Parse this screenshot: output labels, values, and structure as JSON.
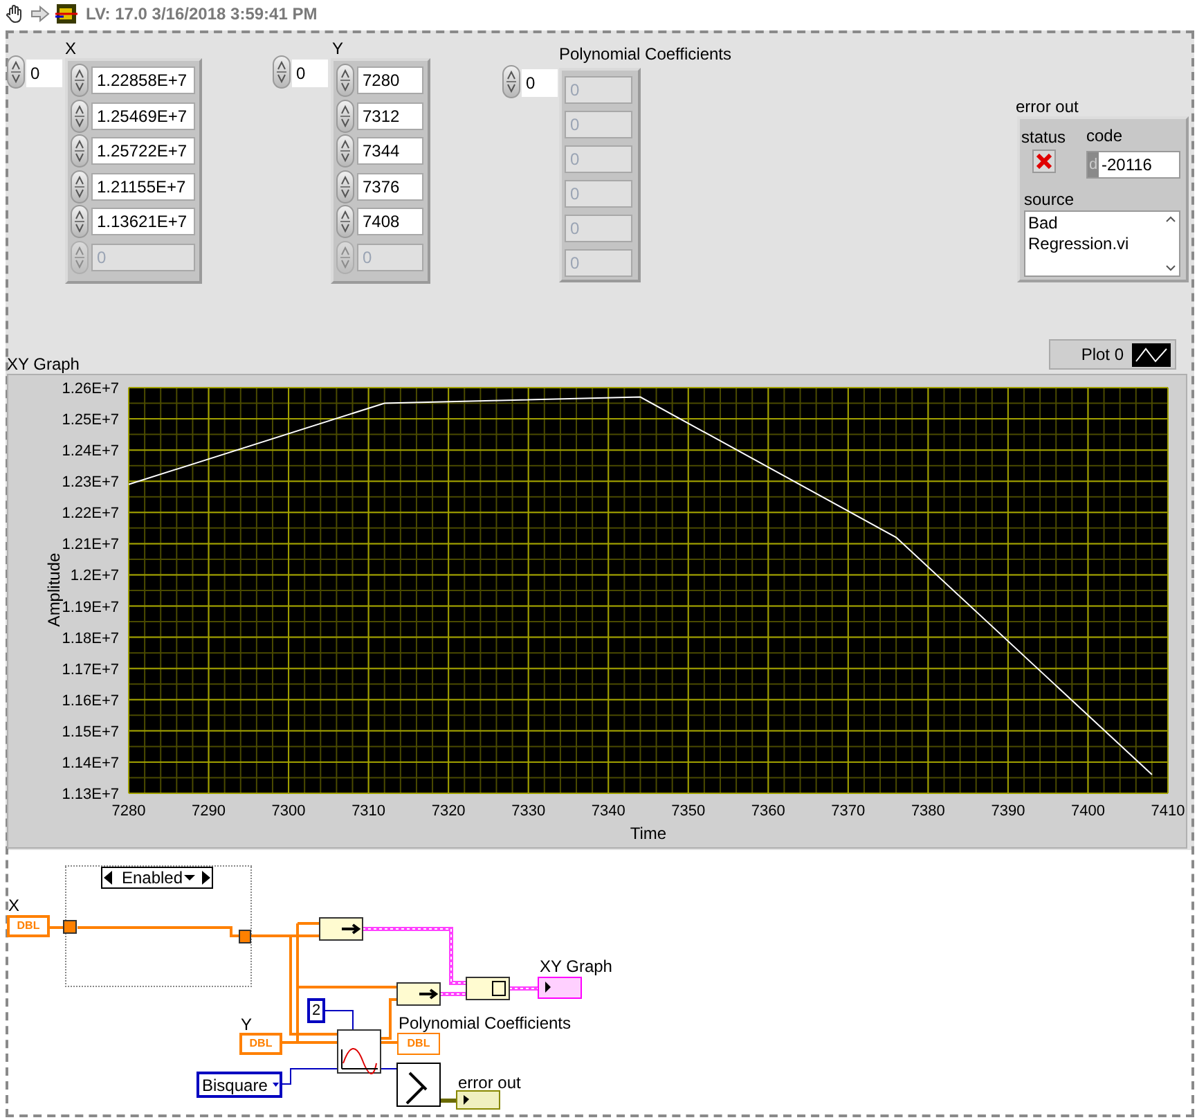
{
  "toolbar": {
    "title": "LV: 17.0 3/16/2018 3:59:41 PM"
  },
  "front_panel": {
    "x_array": {
      "label": "X",
      "index": "0",
      "elements": [
        {
          "value": "1.22858E+7",
          "disabled": false
        },
        {
          "value": "1.25469E+7",
          "disabled": false
        },
        {
          "value": "1.25722E+7",
          "disabled": false
        },
        {
          "value": "1.21155E+7",
          "disabled": false
        },
        {
          "value": "1.13621E+7",
          "disabled": false
        },
        {
          "value": "0",
          "disabled": true
        }
      ]
    },
    "y_array": {
      "label": "Y",
      "index": "0",
      "elements": [
        {
          "value": "7280",
          "disabled": false
        },
        {
          "value": "7312",
          "disabled": false
        },
        {
          "value": "7344",
          "disabled": false
        },
        {
          "value": "7376",
          "disabled": false
        },
        {
          "value": "7408",
          "disabled": false
        },
        {
          "value": "0",
          "disabled": true
        }
      ]
    },
    "coefficients": {
      "label": "Polynomial Coefficients",
      "index": "0",
      "elements": [
        {
          "value": "0",
          "disabled": true
        },
        {
          "value": "0",
          "disabled": true
        },
        {
          "value": "0",
          "disabled": true
        },
        {
          "value": "0",
          "disabled": true
        },
        {
          "value": "0",
          "disabled": true
        },
        {
          "value": "0",
          "disabled": true
        }
      ]
    },
    "error_out": {
      "label": "error out",
      "status_label": "status",
      "status": true,
      "code_label": "code",
      "radix": "d",
      "code": "-20116",
      "source_label": "source",
      "source": "Bad Regression.vi"
    },
    "graph": {
      "label": "XY Graph",
      "chart_data": {
        "type": "line",
        "xlabel": "Time",
        "ylabel": "Amplitude",
        "x": [
          7280,
          7312,
          7344,
          7376,
          7408
        ],
        "series": [
          {
            "name": "Plot 0",
            "color": "#ffffff",
            "values": [
              12290000,
              12550000,
              12570000,
              12120000,
              11360000
            ]
          }
        ],
        "grid": true,
        "xlim": [
          7280,
          7410
        ],
        "ylim": [
          11300000,
          12600000
        ],
        "xticks": [
          7280,
          7290,
          7300,
          7310,
          7320,
          7330,
          7340,
          7350,
          7360,
          7370,
          7380,
          7390,
          7400,
          7410
        ],
        "yticks": [
          {
            "value": 12600000,
            "label": "1.26E+7"
          },
          {
            "value": 12500000,
            "label": "1.25E+7"
          },
          {
            "value": 12400000,
            "label": "1.24E+7"
          },
          {
            "value": 12300000,
            "label": "1.23E+7"
          },
          {
            "value": 12200000,
            "label": "1.22E+7"
          },
          {
            "value": 12100000,
            "label": "1.21E+7"
          },
          {
            "value": 12000000,
            "label": "1.2E+7"
          },
          {
            "value": 11900000,
            "label": "1.19E+7"
          },
          {
            "value": 11800000,
            "label": "1.18E+7"
          },
          {
            "value": 11700000,
            "label": "1.17E+7"
          },
          {
            "value": 11600000,
            "label": "1.16E+7"
          },
          {
            "value": 11500000,
            "label": "1.15E+7"
          },
          {
            "value": 11400000,
            "label": "1.14E+7"
          },
          {
            "value": 11300000,
            "label": "1.13E+7"
          }
        ]
      }
    }
  },
  "block_diagram": {
    "disabled_structure": {
      "selector": "Enabled"
    },
    "x_terminal": {
      "label": "X",
      "type": "DBL"
    },
    "graph_terminal": {
      "label": "XY Graph"
    },
    "constant": {
      "value": "2"
    },
    "y_terminal": {
      "label": "Y",
      "type": "DBL"
    },
    "coefficients_terminal": {
      "label": "Polynomial Coefficients",
      "type": "DBL"
    },
    "ring_constant": {
      "value": "Bisquare"
    },
    "error_terminal": {
      "label": "error out"
    }
  }
}
